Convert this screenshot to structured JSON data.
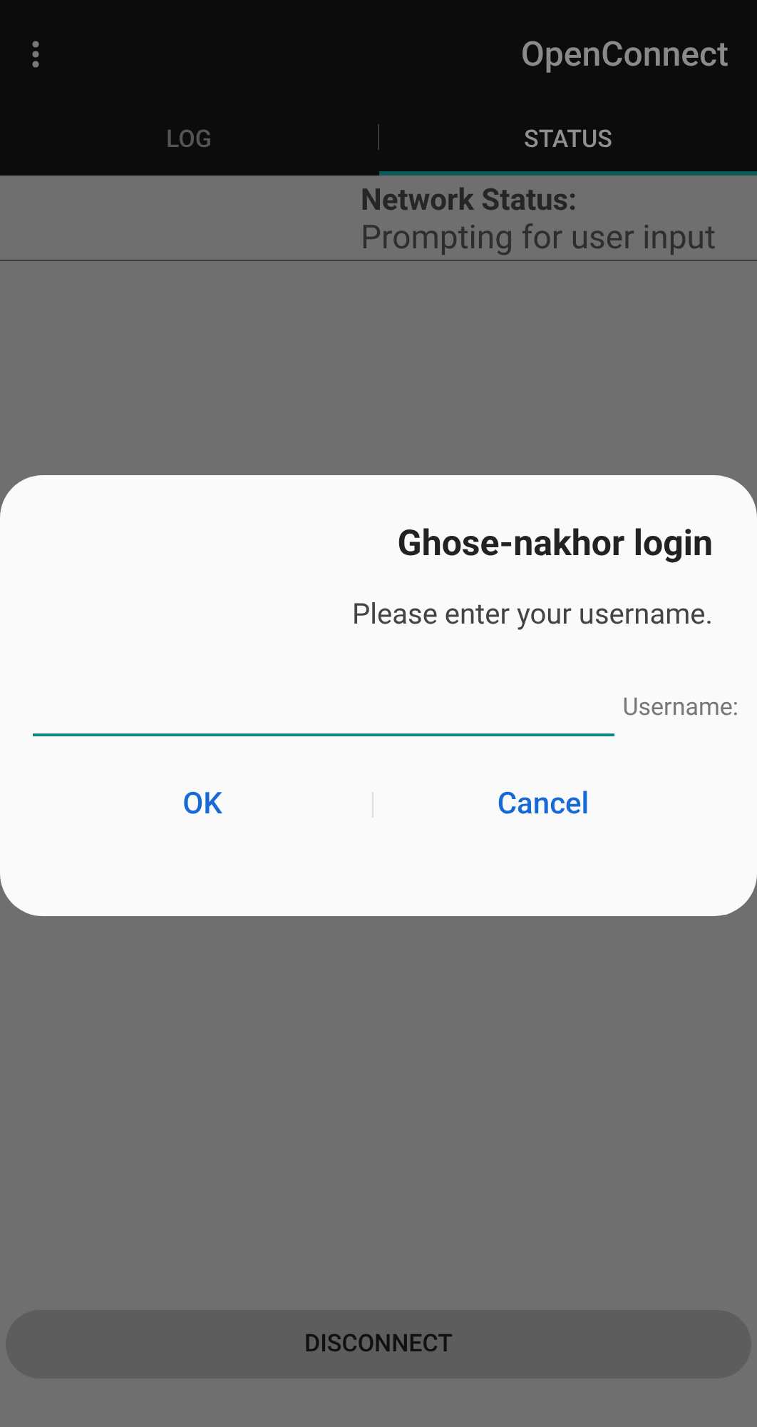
{
  "app_bar": {
    "title": "OpenConnect"
  },
  "tabs": [
    {
      "label": "LOG",
      "selected": false
    },
    {
      "label": "STATUS",
      "selected": true
    }
  ],
  "status": {
    "heading": "Network Status:",
    "value": "Prompting for user input"
  },
  "dialog": {
    "title": "Ghose-nakhor login",
    "message": "Please enter your username.",
    "field_label": "Username:",
    "buttons": [
      "OK",
      "Cancel"
    ]
  },
  "disconnect_button": "DISCONNECT"
}
